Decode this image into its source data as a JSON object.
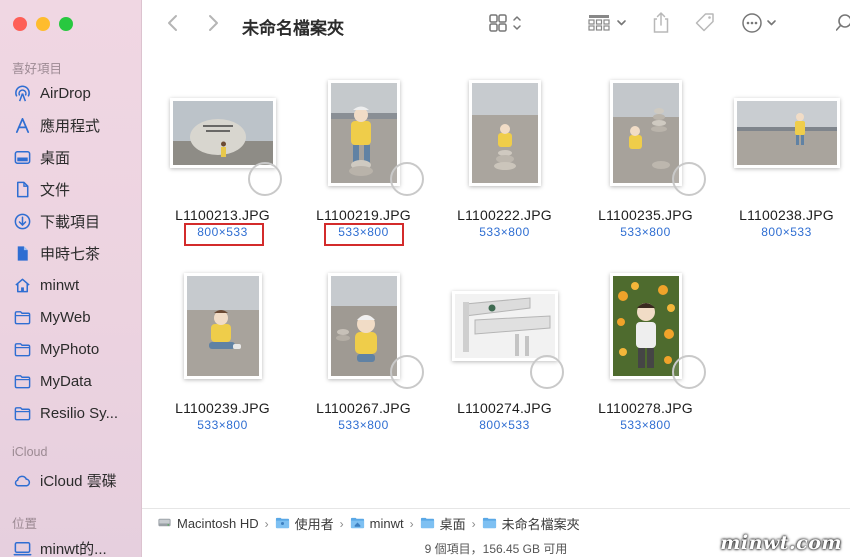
{
  "sidebar": {
    "favorites_header": "喜好項目",
    "items": [
      {
        "label": "AirDrop",
        "icon": "airdrop-icon"
      },
      {
        "label": "應用程式",
        "icon": "applications-icon"
      },
      {
        "label": "桌面",
        "icon": "desktop-icon"
      },
      {
        "label": "文件",
        "icon": "document-icon"
      },
      {
        "label": "下載項目",
        "icon": "downloads-icon"
      },
      {
        "label": "申時七茶",
        "icon": "file-icon"
      },
      {
        "label": "minwt",
        "icon": "home-icon"
      },
      {
        "label": "MyWeb",
        "icon": "folder-icon"
      },
      {
        "label": "MyPhoto",
        "icon": "folder-icon"
      },
      {
        "label": "MyData",
        "icon": "folder-icon"
      },
      {
        "label": "Resilio Sy...",
        "icon": "folder-icon"
      }
    ],
    "icloud_header": "iCloud",
    "icloud_items": [
      {
        "label": "iCloud 雲碟",
        "icon": "cloud-icon"
      }
    ],
    "locations_header": "位置",
    "location_items": [
      {
        "label": "minwt的...",
        "icon": "computer-icon"
      }
    ]
  },
  "toolbar": {
    "title": "未命名檔案夾",
    "back_icon": "chevron-left-icon",
    "forward_icon": "chevron-right-icon"
  },
  "files": [
    {
      "name": "L1100213.JPG",
      "dims": "800×533",
      "orientation": "landscape",
      "highlighted": true
    },
    {
      "name": "L1100219.JPG",
      "dims": "533×800",
      "orientation": "portrait",
      "highlighted": true
    },
    {
      "name": "L1100222.JPG",
      "dims": "533×800",
      "orientation": "portrait",
      "highlighted": false
    },
    {
      "name": "L1100235.JPG",
      "dims": "533×800",
      "orientation": "portrait",
      "highlighted": false
    },
    {
      "name": "L1100238.JPG",
      "dims": "800×533",
      "orientation": "landscape",
      "highlighted": false
    },
    {
      "name": "L1100239.JPG",
      "dims": "533×800",
      "orientation": "portrait",
      "highlighted": false
    },
    {
      "name": "L1100267.JPG",
      "dims": "533×800",
      "orientation": "portrait",
      "highlighted": false
    },
    {
      "name": "L1100274.JPG",
      "dims": "800×533",
      "orientation": "landscape",
      "highlighted": false
    },
    {
      "name": "L1100278.JPG",
      "dims": "533×800",
      "orientation": "portrait",
      "highlighted": false
    }
  ],
  "pathbar": {
    "crumbs": [
      {
        "label": "Macintosh HD",
        "icon": "disk-icon"
      },
      {
        "label": "使用者",
        "icon": "folder-icon"
      },
      {
        "label": "minwt",
        "icon": "home-folder-icon"
      },
      {
        "label": "桌面",
        "icon": "folder-icon"
      },
      {
        "label": "未命名檔案夾",
        "icon": "folder-icon"
      }
    ]
  },
  "status": "9 個項目，156.45 GB 可用",
  "watermark": "minwt.com",
  "colors": {
    "accent": "#2f6ed2",
    "highlight_box": "#d32b2b",
    "sidebar_bg": "#eed5e2"
  }
}
